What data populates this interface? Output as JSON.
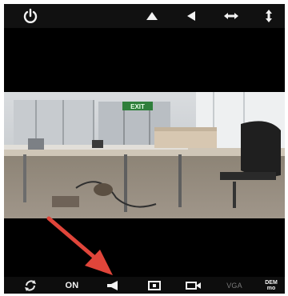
{
  "top_bar": {
    "icons": [
      "power-icon",
      "vertical-flip-icon",
      "horizontal-flip-icon",
      "collapse-horizontal-icon",
      "collapse-vertical-icon"
    ]
  },
  "camera_view": {
    "sign_text": "EXIT"
  },
  "bottom_bar": {
    "rotate_icon": "rotate-icon",
    "on_label": "ON",
    "speaker_icon": "speaker-icon",
    "snapshot_icon": "snapshot-icon",
    "record_icon": "record-icon",
    "quality_label": "VGA",
    "resolution_label_top": "DEM",
    "resolution_label_bottom": "mo"
  },
  "annotation": {
    "arrow_color": "#e0453a"
  }
}
